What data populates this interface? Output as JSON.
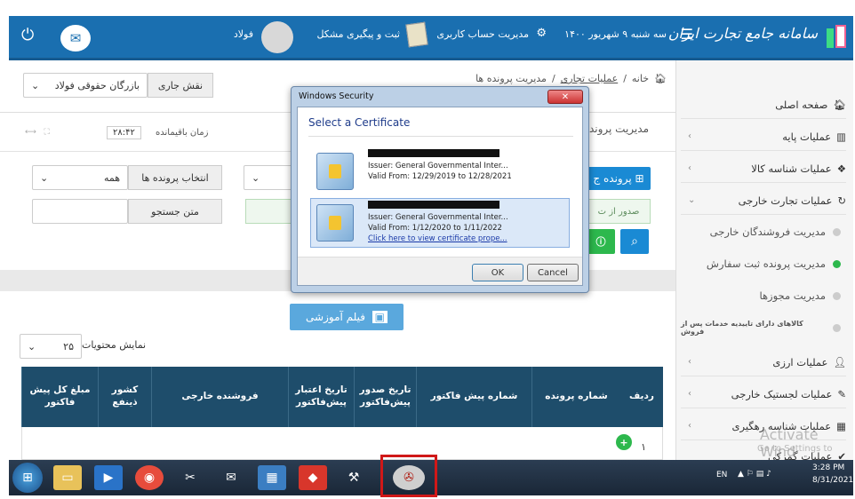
{
  "header": {
    "brand": "سامانه جامع تجارت ایران",
    "menu_icon": "hamburger-icon",
    "date": "سه شنبه ۹ شهریور ۱۴۰۰",
    "account": "مدیریت حساب کاربری",
    "support": "ثبت و پیگیری مشکل",
    "user": "فولاد",
    "colors": {
      "bar": "#1a6fb0",
      "accent": "#1a8ad4"
    }
  },
  "breadcrumb": {
    "home": "خانه",
    "sep": "/",
    "level2": "عملیات تجاری",
    "level3": "مدیریت پرونده ها"
  },
  "page": {
    "title_partial": "مدیریت پرونده"
  },
  "role": {
    "label": "نقش جاری",
    "value": "بازرگان حقوقی فولاد"
  },
  "timer": {
    "label": "زمان باقیمانده",
    "value": "۲۸:۴۲"
  },
  "filters": {
    "select_label": "انتخاب پرونده ها",
    "select_value": "همه",
    "search_label": "متن جستجو"
  },
  "actions": {
    "new_file": "پرونده ج",
    "issue_partial": "صدور از ت"
  },
  "training": {
    "label": "فیلم آموزشی"
  },
  "content_display": {
    "label": "نمایش محتویات",
    "value": "۲۵"
  },
  "table": {
    "headers": [
      "ردیف",
      "شماره پرونده",
      "شماره پیش فاکتور",
      "تاریخ صدور پیش‌فاکتور",
      "تاریخ اعتبار پیش‌فاکتور",
      "فروشنده خارجی",
      "کشور ذینفع",
      "مبلغ کل پیش فاکتور"
    ],
    "rows": [
      {
        "index": "۱"
      }
    ]
  },
  "sidebar": {
    "items": [
      {
        "label": "صفحه اصلی",
        "icon": "home-icon"
      },
      {
        "label": "عملیات پایه",
        "icon": "bar-chart-icon"
      },
      {
        "label": "عملیات شناسه کالا",
        "icon": "cubes-icon"
      },
      {
        "label": "عملیات تجارت خارجی",
        "icon": "refresh-icon"
      }
    ],
    "subitems": [
      {
        "label": "مدیریت فروشندگان خارجی",
        "active": false
      },
      {
        "label": "مدیریت پرونده ثبت سفارش",
        "active": true
      },
      {
        "label": "مدیریت مجوزها",
        "active": false
      },
      {
        "label": "کالاهای دارای تاییدیه خدمات پس از فروش",
        "active": false
      }
    ],
    "items2": [
      {
        "label": "عملیات ارزی",
        "icon": "user-plus-icon"
      },
      {
        "label": "عملیات لجستیک خارجی",
        "icon": "edit-icon"
      },
      {
        "label": "عملیات شناسه رهگیری",
        "icon": "barcode-icon"
      },
      {
        "label": "عملیات گمرکی",
        "icon": "check-icon"
      }
    ]
  },
  "dialog": {
    "title": "Windows Security",
    "heading": "Select a Certificate",
    "certs": [
      {
        "issuer": "Issuer: General Governmental Inter...",
        "valid": "Valid From: 12/29/2019 to 12/28/2021"
      },
      {
        "issuer": "Issuer: General Governmental Inter...",
        "valid": "Valid From: 1/12/2020 to 1/11/2022",
        "link": "Click here to view certificate prope..."
      }
    ],
    "ok": "OK",
    "cancel": "Cancel"
  },
  "watermark": {
    "line1": "Activate Wind",
    "line2": "Go to Settings to"
  },
  "tray": {
    "lang": "EN",
    "time": "3:28 PM",
    "date": "8/31/2021"
  }
}
